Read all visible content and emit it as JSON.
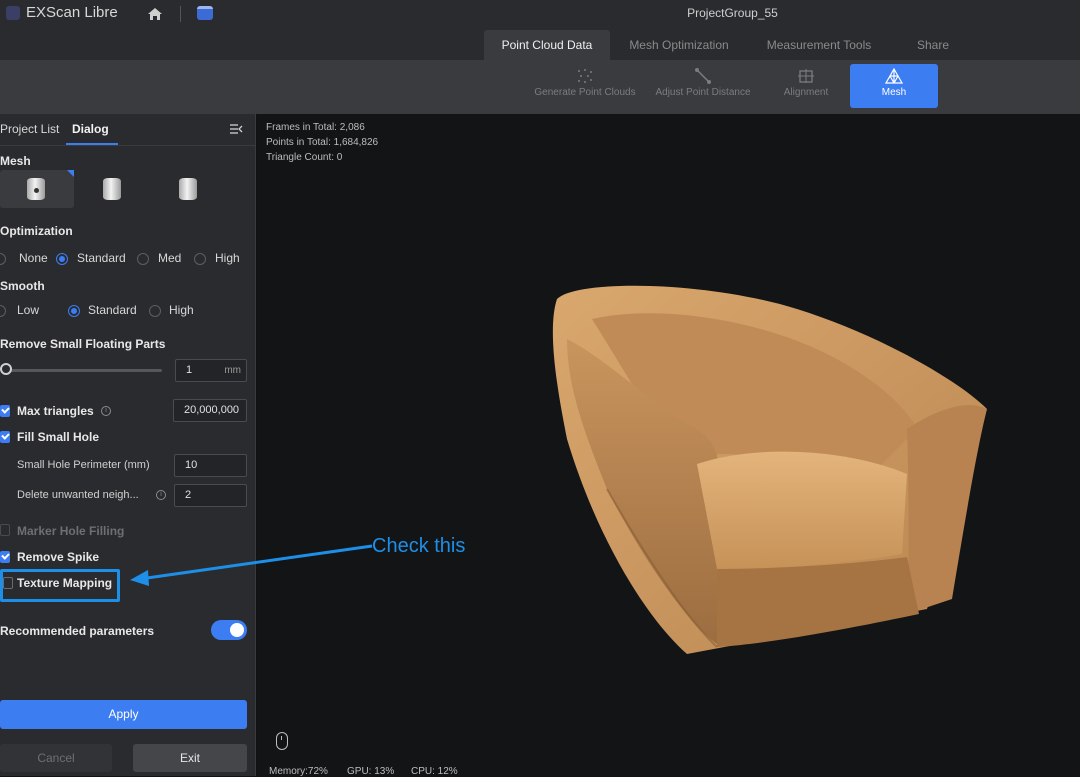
{
  "titlebar": {
    "app_name": "EXScan Libre",
    "project_name": "ProjectGroup_55",
    "icons": [
      "app-logo-icon",
      "home-icon",
      "window-icon"
    ]
  },
  "main_tabs": [
    {
      "label": "Point Cloud Data",
      "active": true
    },
    {
      "label": "Mesh Optimization",
      "active": false
    },
    {
      "label": "Measurement Tools",
      "active": false
    },
    {
      "label": "Share",
      "active": false
    }
  ],
  "toolbar": [
    {
      "label": "Generate Point Clouds",
      "icon": "point-cloud-icon",
      "active": false
    },
    {
      "label": "Adjust Point Distance",
      "icon": "distance-icon",
      "active": false
    },
    {
      "label": "Alignment",
      "icon": "alignment-icon",
      "active": false
    },
    {
      "label": "Mesh",
      "icon": "mesh-icon",
      "active": true
    }
  ],
  "panel": {
    "tabs": {
      "project_list": "Project List",
      "dialog": "Dialog"
    },
    "mesh": {
      "title": "Mesh",
      "options": [
        "watertight-mesh-icon",
        "unwatertight-mesh-icon",
        "semi-watertight-mesh-icon"
      ],
      "selected": 0
    },
    "optimization": {
      "title": "Optimization",
      "options": [
        "None",
        "Standard",
        "Med",
        "High"
      ],
      "selected": "Standard"
    },
    "smooth": {
      "title": "Smooth",
      "options": [
        "Low",
        "Standard",
        "High"
      ],
      "selected": "Standard"
    },
    "floating": {
      "title": "Remove Small Floating Parts",
      "value": "1",
      "unit": "mm"
    },
    "max_triangles": {
      "label": "Max triangles",
      "checked": true,
      "value": "20,000,000"
    },
    "fill_small_hole": {
      "label": "Fill Small Hole",
      "checked": true
    },
    "small_hole_perimeter": {
      "label": "Small Hole Perimeter (mm)",
      "value": "10"
    },
    "delete_unwanted": {
      "label": "Delete unwanted neigh...",
      "value": "2"
    },
    "marker_hole_filling": {
      "label": "Marker Hole Filling",
      "checked": false,
      "disabled": true
    },
    "remove_spike": {
      "label": "Remove Spike",
      "checked": true
    },
    "texture_mapping": {
      "label": "Texture Mapping",
      "checked": false
    },
    "recommended": {
      "label": "Recommended parameters",
      "enabled": true
    },
    "buttons": {
      "apply": "Apply",
      "cancel": "Cancel",
      "exit": "Exit"
    }
  },
  "viewport": {
    "stats": {
      "frames": "Frames in Total: 2,086",
      "points": "Points in Total: 1,684,826",
      "triangles": "Triangle Count: 0"
    },
    "footer": {
      "memory": "Memory:72%",
      "gpu": "GPU: 13%",
      "cpu": "CPU: 12%"
    },
    "model": "armchair-3d-scan"
  },
  "annotation": {
    "callout": "Check this",
    "color": "#1e8fe8"
  },
  "colors": {
    "accent": "#3c7df2",
    "panel_bg": "#2a2b2e",
    "viewport_bg": "#131416",
    "chair": "#c89560"
  }
}
